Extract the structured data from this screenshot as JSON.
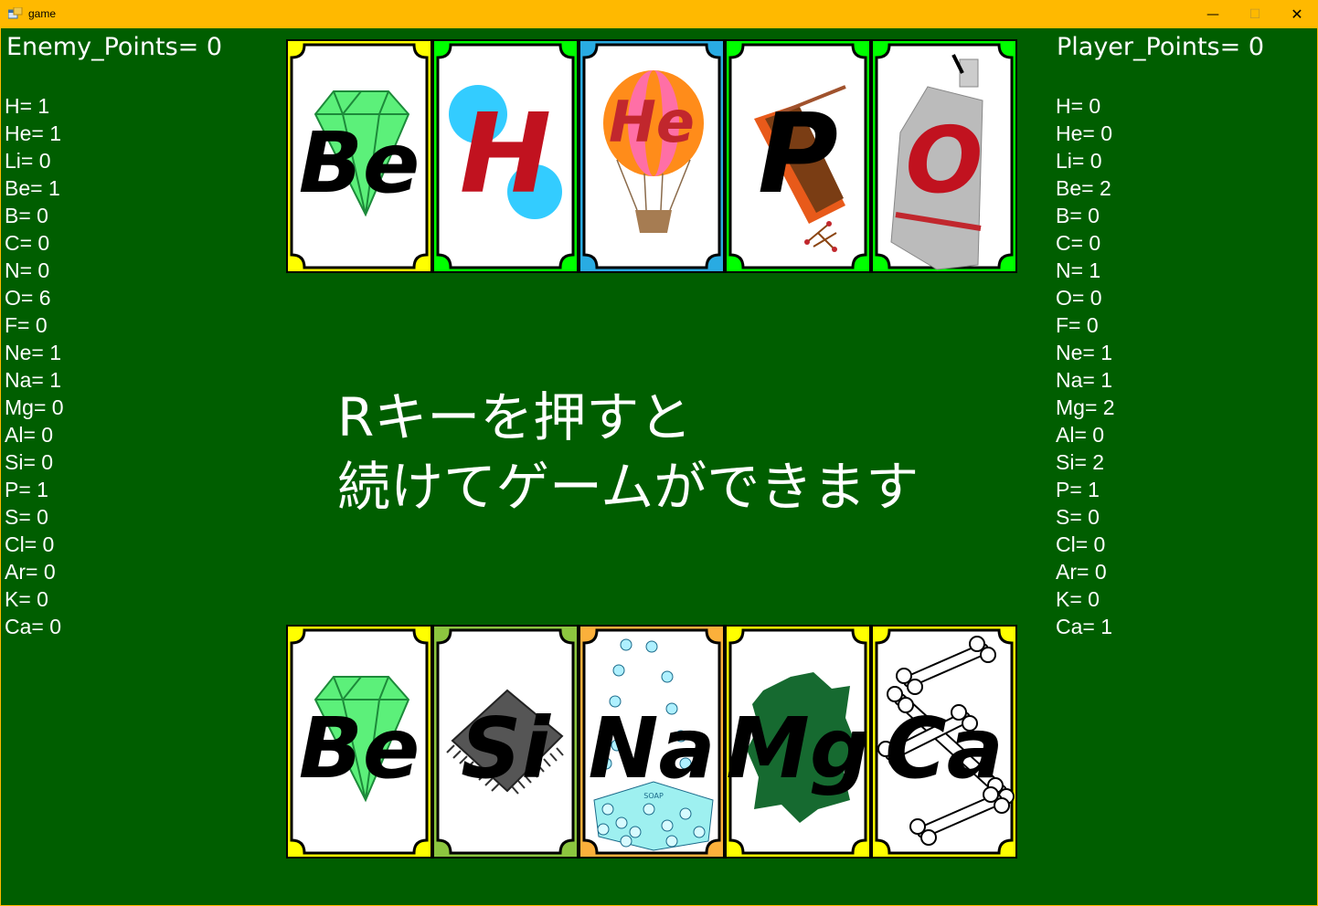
{
  "window": {
    "title": "game",
    "minimize_glyph": "—",
    "maximize_glyph": "☐",
    "close_glyph": "✕"
  },
  "enemy": {
    "points_label": "Enemy_Points= 0",
    "counts": [
      "H= 1",
      "He= 1",
      "Li= 0",
      "Be= 1",
      "B= 0",
      "C= 0",
      "N= 0",
      "O= 6",
      "F= 0",
      "Ne= 1",
      "Na= 1",
      "Mg= 0",
      "Al= 0",
      "Si= 0",
      "P= 1",
      "S= 0",
      "Cl= 0",
      "Ar= 0",
      "K= 0",
      "Ca= 0"
    ],
    "cards": [
      {
        "symbol": "Be",
        "frame_color": "#ffff00",
        "art": "diamond-icon"
      },
      {
        "symbol": "H",
        "frame_color": "#00ff00",
        "art": "bubbles-icon"
      },
      {
        "symbol": "He",
        "frame_color": "#29abe2",
        "art": "balloon-icon"
      },
      {
        "symbol": "P",
        "frame_color": "#00ff00",
        "art": "matchbox-icon"
      },
      {
        "symbol": "O",
        "frame_color": "#00ff00",
        "art": "oxygen-tank-icon"
      }
    ]
  },
  "player": {
    "points_label": "Player_Points= 0",
    "counts": [
      "H= 0",
      "He= 0",
      "Li= 0",
      "Be= 2",
      "B= 0",
      "C= 0",
      "N= 1",
      "O= 0",
      "F= 0",
      "Ne= 1",
      "Na= 1",
      "Mg= 2",
      "Al= 0",
      "Si= 2",
      "P= 1",
      "S= 0",
      "Cl= 0",
      "Ar= 0",
      "K= 0",
      "Ca= 1"
    ],
    "cards": [
      {
        "symbol": "Be",
        "frame_color": "#ffff00",
        "art": "diamond-icon"
      },
      {
        "symbol": "Si",
        "frame_color": "#8cc63f",
        "art": "chip-icon"
      },
      {
        "symbol": "Na",
        "frame_color": "#fbb03b",
        "art": "soap-icon"
      },
      {
        "symbol": "Mg",
        "frame_color": "#ffff00",
        "art": "leaf-icon"
      },
      {
        "symbol": "Ca",
        "frame_color": "#ffff00",
        "art": "bone-icon"
      }
    ]
  },
  "message": {
    "line1": "Rキーを押すと",
    "line2": "続けてゲームができます"
  },
  "colors": {
    "table": "#005e00",
    "titlebar": "#ffb900",
    "text": "#ffffff"
  },
  "soap_label": "SOAP"
}
